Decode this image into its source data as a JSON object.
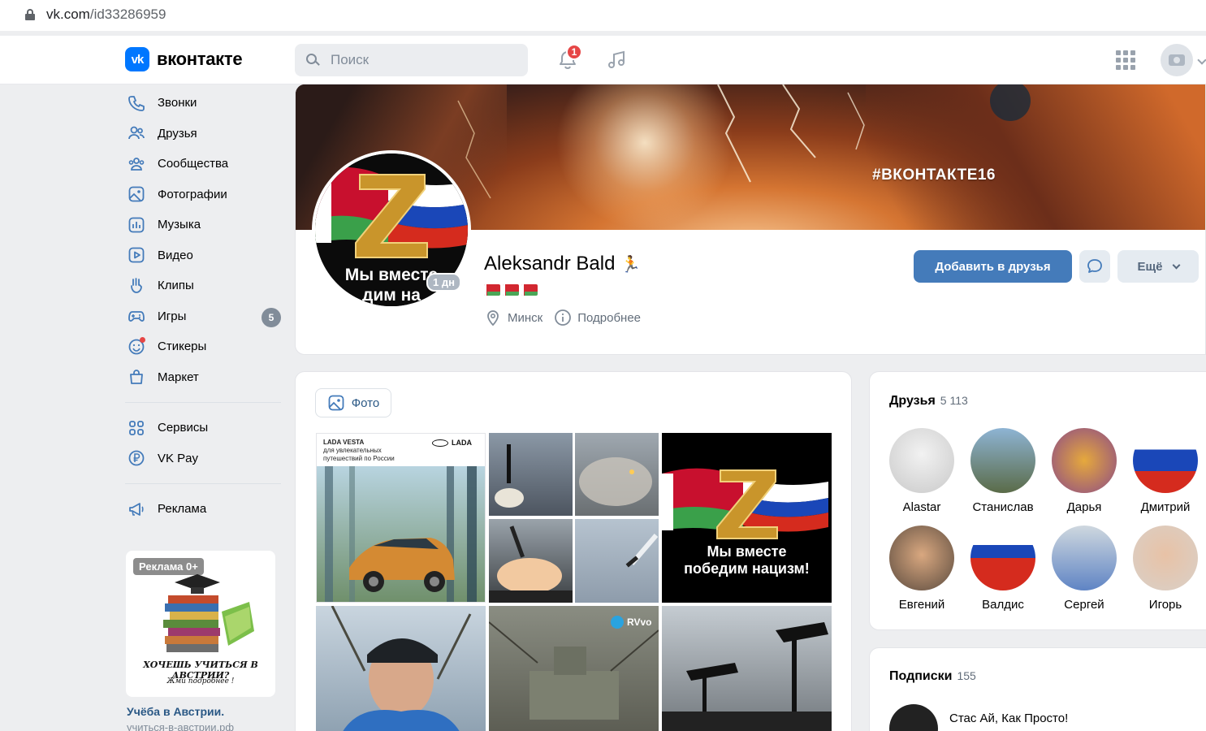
{
  "browser": {
    "url_host": "vk.com",
    "url_path": "/id33286959"
  },
  "header": {
    "logo_mark": "vk",
    "logo_text": "вконтакте",
    "search_placeholder": "Поиск",
    "notifications_count": "1",
    "icons": [
      "search-icon",
      "bell-icon",
      "music-icon",
      "apps-grid-icon",
      "camera-icon"
    ]
  },
  "sidebar": {
    "items": [
      {
        "label": "Звонки",
        "icon": "phone-icon"
      },
      {
        "label": "Друзья",
        "icon": "friends-icon"
      },
      {
        "label": "Сообщества",
        "icon": "communities-icon"
      },
      {
        "label": "Фотографии",
        "icon": "photo-icon"
      },
      {
        "label": "Музыка",
        "icon": "music-icon"
      },
      {
        "label": "Видео",
        "icon": "video-icon"
      },
      {
        "label": "Клипы",
        "icon": "clips-icon"
      },
      {
        "label": "Игры",
        "icon": "gamepad-icon",
        "badge": "5"
      },
      {
        "label": "Стикеры",
        "icon": "sticker-icon"
      },
      {
        "label": "Маркет",
        "icon": "market-icon"
      }
    ],
    "extra": [
      {
        "label": "Сервисы",
        "icon": "services-icon"
      },
      {
        "label": "VK Pay",
        "icon": "vkpay-icon"
      }
    ],
    "ads_link": {
      "label": "Реклама",
      "icon": "megaphone-icon"
    },
    "ad": {
      "label": "Реклама 0+",
      "caption": "ХОЧЕШЬ УЧИТЬСЯ В АВСТРИИ?",
      "caption2": "Жми подробнее !",
      "title": "Учёба в Австрии.",
      "url": "учиться-в-австрии.рф"
    }
  },
  "profile": {
    "cover_tag": "#ВКОНТАКТЕ16",
    "name": "Aleksandr Bald",
    "name_emoji": "🏃",
    "online": "1 дн",
    "avatar_text1": "Мы вместе",
    "avatar_text2": "дим на",
    "city": "Минск",
    "details": "Подробнее",
    "add_friend": "Добавить в друзья",
    "more": "Ещё"
  },
  "photos": {
    "tab_label": "Фото",
    "lada_title": "LADA VESTA",
    "lada_sub": "для увлекательных путешествий по России",
    "lada_brand": "LADA",
    "z_text1": "Мы вместе",
    "z_text2": "победим нацизм!",
    "tg_label": "RVvo"
  },
  "friends": {
    "title": "Друзья",
    "count": "5 113",
    "list": [
      "Alastar",
      "Станислав",
      "Дарья",
      "Дмитрий",
      "Евгений",
      "Валдис",
      "Сергей",
      "Игорь"
    ]
  },
  "subscriptions": {
    "title": "Подписки",
    "count": "155",
    "first": "Стас Ай, Как Просто!"
  },
  "colors": {
    "accent": "#447bba",
    "vk_blue": "#0077ff",
    "link": "#2a5885",
    "badge_red": "#e64646"
  }
}
